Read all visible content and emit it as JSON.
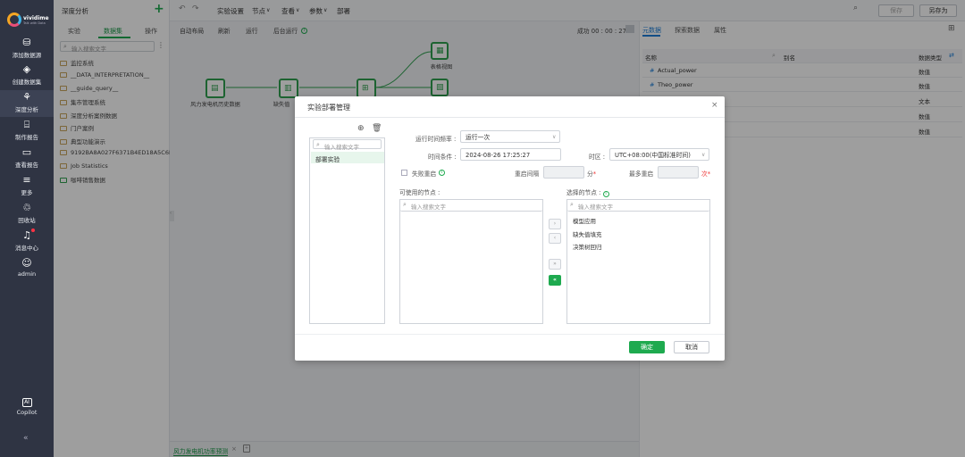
{
  "nav": {
    "brand": "vividime",
    "brand_sub": "Talk with Data",
    "items": [
      {
        "label": "添加数据源",
        "icon": "database-icon"
      },
      {
        "label": "创建数据集",
        "icon": "dataset-icon"
      },
      {
        "label": "深度分析",
        "icon": "analysis-icon"
      },
      {
        "label": "制作报告",
        "icon": "report-icon"
      },
      {
        "label": "查看报告",
        "icon": "view-report-icon"
      },
      {
        "label": "更多",
        "icon": "menu-icon"
      },
      {
        "label": "回收站",
        "icon": "trash-icon"
      },
      {
        "label": "消息中心",
        "icon": "bell-icon"
      },
      {
        "label": "admin",
        "icon": "user-icon"
      }
    ],
    "copilot": "Copilot",
    "collapse": "«"
  },
  "panel": {
    "title": "深度分析",
    "add": "+",
    "tabs": [
      "实验",
      "数据集",
      "操作"
    ],
    "search_placeholder": "输入搜索文字",
    "tree": [
      "监控系统",
      "__DATA_INTERPRETATION__",
      "__guide_query__",
      "集市管理系统",
      "深度分析案例数据",
      "门户案例",
      "典型功能演示",
      "9192BA8A027F6371B4ED18A5C6EED",
      "Job Statistics",
      "咖啡销售数据"
    ]
  },
  "toolbar": {
    "undo": "↶",
    "redo": "↷",
    "items": [
      "实验设置",
      "节点",
      "查看",
      "参数",
      "部署"
    ],
    "save": "保存",
    "saveas": "另存为"
  },
  "subtoolbar": {
    "items": [
      "自动布局",
      "刷新",
      "运行",
      "后台运行"
    ],
    "status": "成功 00 : 00 : 27"
  },
  "canvas": {
    "nodes": [
      "风力发电机历史数据",
      "缺失值",
      "表格视图"
    ]
  },
  "right": {
    "tabs": [
      "元数据",
      "探索数据",
      "属性"
    ],
    "col_name": "名称",
    "col_alias": "别名",
    "col_type": "数据类型",
    "rows": [
      {
        "name": "Actual_power",
        "type": "数值"
      },
      {
        "name": "Theo_power",
        "type": "数值"
      },
      {
        "name": "",
        "type": "文本"
      },
      {
        "name": "",
        "type": "数值"
      },
      {
        "name": "",
        "type": "数值"
      }
    ]
  },
  "bottom": {
    "tab": "风力发电机功率预测",
    "close": "×"
  },
  "dialog": {
    "title": "实验部署管理",
    "close": "×",
    "search_placeholder": "输入搜索文字",
    "list": [
      "部署实验"
    ],
    "freq_label": "运行时间频率 :",
    "freq_value": "运行一次",
    "time_label": "时间条件 :",
    "time_value": "2024-08-26 17:25:27",
    "tz_label": "时区 :",
    "tz_value": "UTC+08:00(中国标准时间)",
    "retry_label": "失败重启",
    "interval_label": "重启间隔",
    "interval_unit": "分",
    "max_label": "最多重启",
    "max_unit": "次",
    "avail_label": "可使用的节点 :",
    "sel_label": "选择的节点 :",
    "selected": [
      "模型应用",
      "缺失值填充",
      "决策树回归"
    ],
    "ok": "确定",
    "cancel": "取消"
  }
}
